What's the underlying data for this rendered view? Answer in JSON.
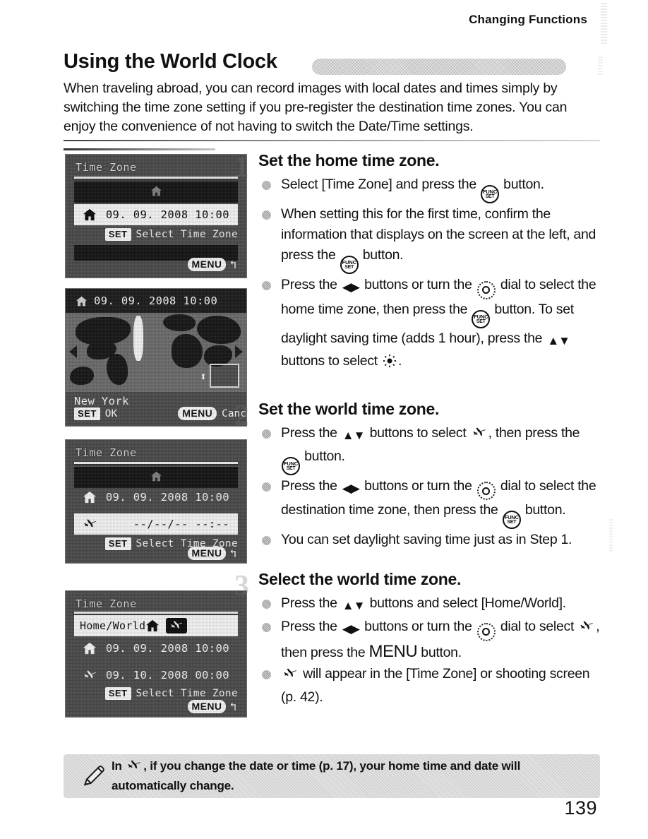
{
  "header": {
    "running_head": "Changing Functions"
  },
  "section": {
    "title": "Using the World Clock",
    "intro": "When traveling abroad, you can record images with local dates and times simply by switching the time zone setting if you pre-register the destination time zones. You can enjoy the convenience of not having to switch the Date/Time settings."
  },
  "screens": [
    {
      "name": "time-zone-home",
      "title": "Time Zone",
      "home_value": "09. 09. 2008  10:00",
      "set_badge": "SET",
      "set_hint": "Select Time Zone",
      "menu_badge": "MENU",
      "return_glyph": "↰"
    },
    {
      "name": "world-map",
      "top_value": "09. 09. 2008  10:00",
      "city": "New York",
      "set_badge": "SET",
      "set_label": "OK",
      "menu_badge": "MENU",
      "menu_label": "Cancel",
      "updown_glyph": "⬍"
    },
    {
      "name": "time-zone-world",
      "title": "Time Zone",
      "home_value": "09. 09. 2008  10:00",
      "world_value": "--/--/--  --:--",
      "set_badge": "SET",
      "set_hint": "Select Time Zone",
      "menu_badge": "MENU",
      "return_glyph": "↰"
    },
    {
      "name": "home-world-select",
      "title": "Time Zone",
      "row_label": "Home/World",
      "home_value": "09. 09. 2008  10:00",
      "world_value": "09. 10. 2008  00:00",
      "set_badge": "SET",
      "set_hint": "Select Time Zone",
      "menu_badge": "MENU",
      "return_glyph": "↰"
    }
  ],
  "steps": [
    {
      "number": "1",
      "heading": "Set the home time zone.",
      "bullets": [
        {
          "parts": [
            {
              "t": "text",
              "v": "Select [Time Zone] and press the "
            },
            {
              "t": "funcset"
            },
            {
              "t": "text",
              "v": " button."
            }
          ]
        },
        {
          "parts": [
            {
              "t": "text",
              "v": "When setting this for the first time, confirm the information that displays on the screen at the left, and press the "
            },
            {
              "t": "funcset"
            },
            {
              "t": "text",
              "v": " button."
            }
          ]
        },
        {
          "parts": [
            {
              "t": "text",
              "v": "Press the "
            },
            {
              "t": "leftright"
            },
            {
              "t": "text",
              "v": " buttons or turn the "
            },
            {
              "t": "dial"
            },
            {
              "t": "text",
              "v": " dial to select the home time zone, then press the "
            },
            {
              "t": "funcset"
            },
            {
              "t": "text",
              "v": " button. To set daylight saving time (adds 1 hour), press the "
            },
            {
              "t": "updown"
            },
            {
              "t": "text",
              "v": " buttons to select "
            },
            {
              "t": "sun"
            },
            {
              "t": "text",
              "v": "."
            }
          ]
        }
      ]
    },
    {
      "number": "2",
      "heading": "Set the world time zone.",
      "bullets": [
        {
          "parts": [
            {
              "t": "text",
              "v": "Press the "
            },
            {
              "t": "updown"
            },
            {
              "t": "text",
              "v": " buttons to select "
            },
            {
              "t": "plane"
            },
            {
              "t": "text",
              "v": ", then press the "
            },
            {
              "t": "funcset"
            },
            {
              "t": "text",
              "v": " button."
            }
          ]
        },
        {
          "parts": [
            {
              "t": "text",
              "v": "Press the "
            },
            {
              "t": "leftright"
            },
            {
              "t": "text",
              "v": " buttons or turn the "
            },
            {
              "t": "dial"
            },
            {
              "t": "text",
              "v": " dial to select the destination time zone, then press the "
            },
            {
              "t": "funcset"
            },
            {
              "t": "text",
              "v": " button."
            }
          ]
        },
        {
          "parts": [
            {
              "t": "text",
              "v": "You can set daylight saving time just as in Step 1."
            }
          ]
        }
      ]
    },
    {
      "number": "3",
      "heading": "Select the world time zone.",
      "bullets": [
        {
          "parts": [
            {
              "t": "text",
              "v": "Press the "
            },
            {
              "t": "updown"
            },
            {
              "t": "text",
              "v": " buttons and select [Home/World]."
            }
          ]
        },
        {
          "parts": [
            {
              "t": "text",
              "v": "Press the "
            },
            {
              "t": "leftright"
            },
            {
              "t": "text",
              "v": " buttons or turn the "
            },
            {
              "t": "dial"
            },
            {
              "t": "text",
              "v": " dial to select "
            },
            {
              "t": "plane"
            },
            {
              "t": "text",
              "v": ", then press the "
            },
            {
              "t": "menuword",
              "v": "MENU"
            },
            {
              "t": "text",
              "v": " button."
            }
          ]
        },
        {
          "parts": [
            {
              "t": "plane"
            },
            {
              "t": "text",
              "v": " will appear in the [Time Zone] or shooting screen (p. 42)."
            }
          ]
        }
      ]
    }
  ],
  "note": {
    "parts": [
      {
        "t": "text",
        "v": "In "
      },
      {
        "t": "plane"
      },
      {
        "t": "text",
        "v": ", if you change the date or time (p. 17), your home time and date will automatically change."
      }
    ]
  },
  "footer": {
    "page_number": "139"
  }
}
